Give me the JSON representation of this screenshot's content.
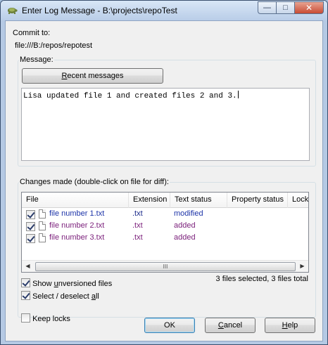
{
  "window": {
    "title": "Enter Log Message - B:\\projects\\repoTest",
    "minimize": "—",
    "maximize": "□",
    "close": "✕"
  },
  "commit": {
    "label": "Commit to:",
    "url": "file:///B:/repos/repotest"
  },
  "message": {
    "group_label": "Message:",
    "recent_prefix": "",
    "recent_underlined": "R",
    "recent_rest": "ecent messages",
    "text": "Lisa updated file 1 and created files 2 and 3."
  },
  "changes": {
    "group_label": "Changes made (double-click on file for diff):",
    "columns": [
      "File",
      "Extension",
      "Text status",
      "Property status",
      "Lock"
    ],
    "rows": [
      {
        "file": "file number 1.txt",
        "extension": ".txt",
        "status": "modified",
        "checked": true
      },
      {
        "file": "file number 2.txt",
        "extension": ".txt",
        "status": "added",
        "checked": true
      },
      {
        "file": "file number 3.txt",
        "extension": ".txt",
        "status": "added",
        "checked": true
      }
    ],
    "scroll_left": "◀",
    "scroll_right": "▶",
    "scroll_thumb": "III",
    "summary": "3 files selected, 3 files total",
    "show_unversioned_pre": "Show ",
    "show_unversioned_u": "u",
    "show_unversioned_post": "nversioned files",
    "select_all_pre": "Select / deselect ",
    "select_all_u": "a",
    "select_all_post": "ll"
  },
  "keep_locks": "Keep locks",
  "buttons": {
    "ok": "OK",
    "cancel_u": "C",
    "cancel_rest": "ancel",
    "help_u": "H",
    "help_rest": "elp"
  },
  "colors": {
    "modified": "#1c33a8",
    "added": "#7a1e7a"
  }
}
